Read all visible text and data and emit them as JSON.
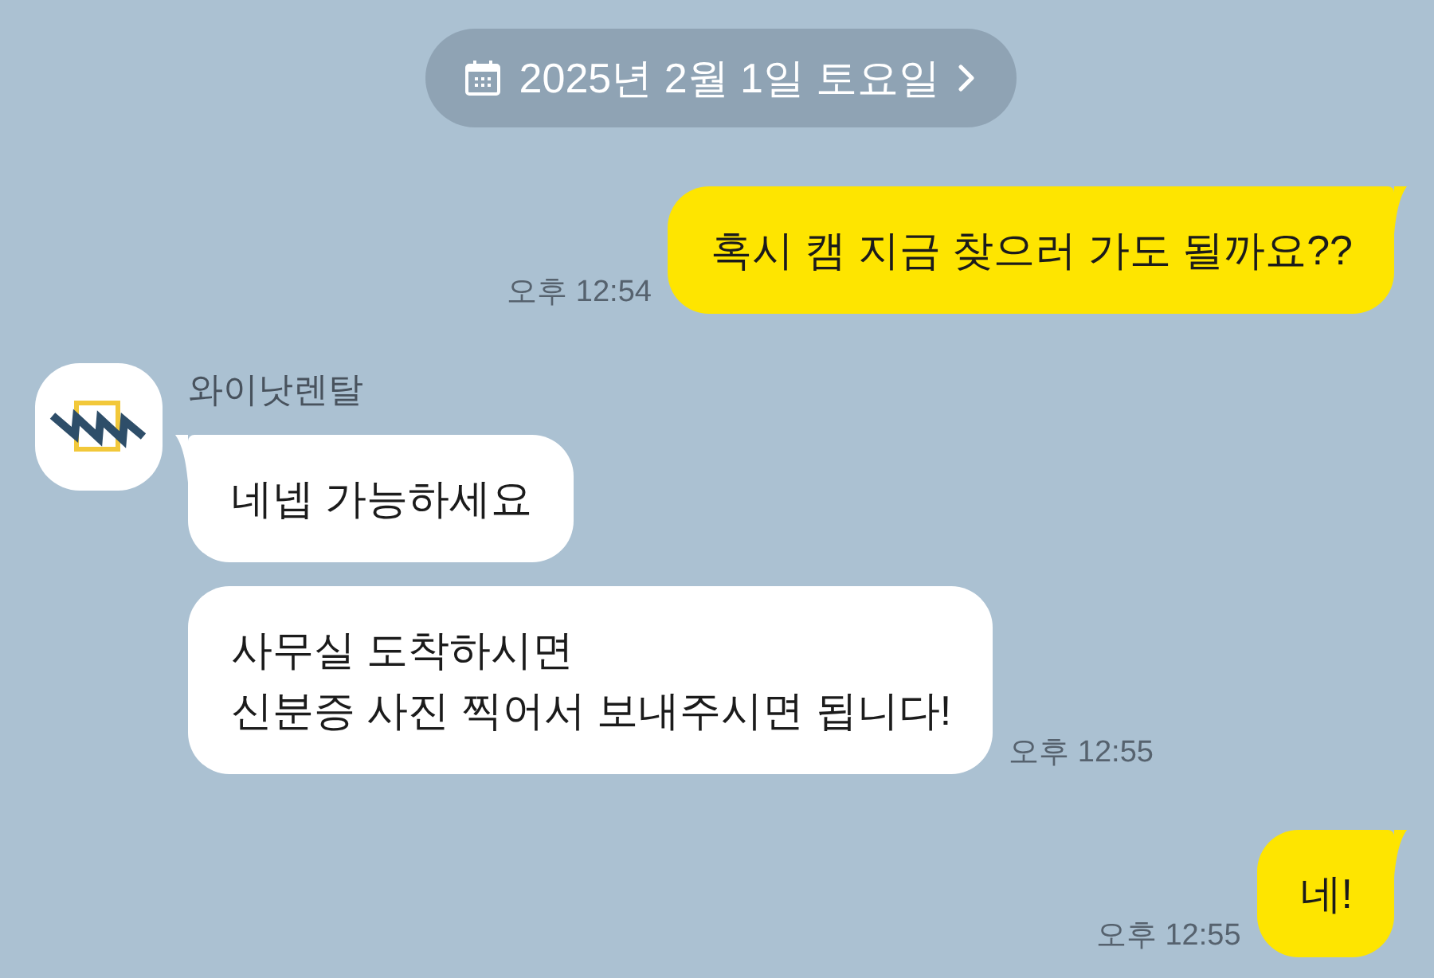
{
  "date_divider": {
    "text": "2025년 2월 1일 토요일"
  },
  "messages": [
    {
      "kind": "sent",
      "bubbles": [
        {
          "text": "혹시 캠 지금 찾으러 가도 될까요??"
        }
      ],
      "time": "오후 12:54"
    },
    {
      "kind": "received",
      "sender": "와이낫렌탈",
      "bubbles": [
        {
          "text": "네넵 가능하세요"
        },
        {
          "text": "사무실 도착하시면\n신분증 사진 찍어서 보내주시면 됩니다!"
        }
      ],
      "time": "오후 12:55"
    },
    {
      "kind": "sent",
      "bubbles": [
        {
          "text": "네!"
        }
      ],
      "time": "오후 12:55"
    }
  ]
}
